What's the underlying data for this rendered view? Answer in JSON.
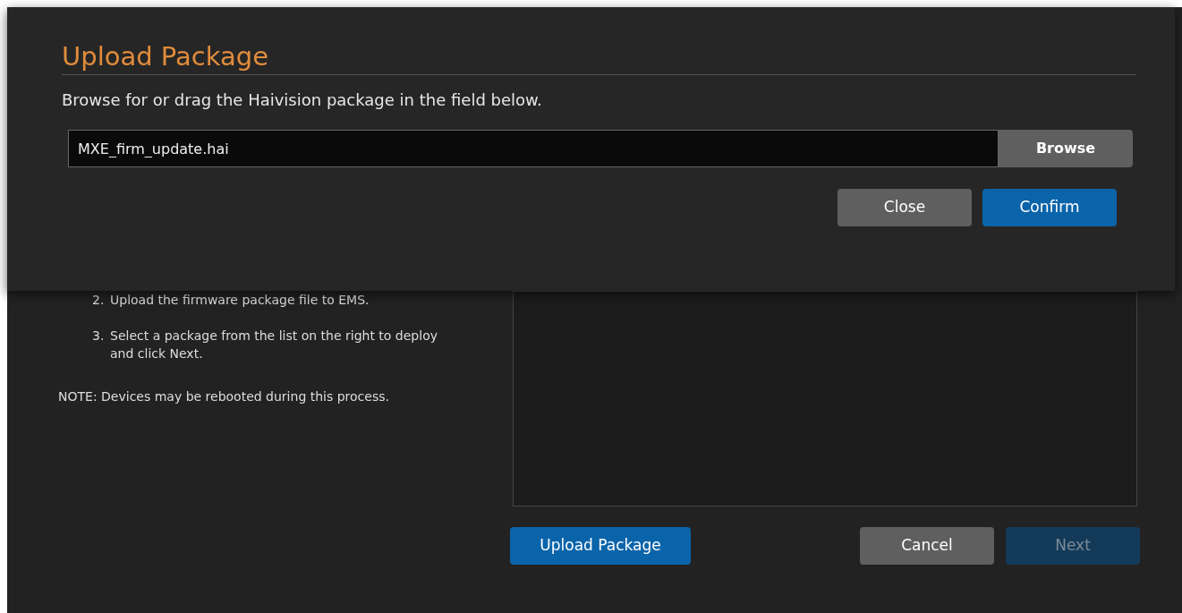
{
  "dialog": {
    "title": "Upload Package",
    "instruction": "Browse for or drag the Haivision package in the field below.",
    "file_field": {
      "value": "MXE_firm_update.hai"
    },
    "browse_button": "Browse",
    "buttons": [
      {
        "label": "Close",
        "kind": "secondary"
      },
      {
        "label": "Confirm",
        "kind": "primary"
      }
    ]
  },
  "steps": [
    {
      "number": "2.",
      "text": "Upload the firmware package file to EMS."
    },
    {
      "number": "3.",
      "text": "Select a package from the list on the right to deploy and click Next."
    }
  ],
  "note": "NOTE: Devices may be rebooted during this process.",
  "upload_button": {
    "label": "Upload Package",
    "kind": "primary",
    "disabled": false
  },
  "footer_buttons": [
    {
      "label": "Cancel",
      "kind": "secondary",
      "disabled": false
    },
    {
      "label": "Next",
      "kind": "primary",
      "disabled": true
    }
  ]
}
